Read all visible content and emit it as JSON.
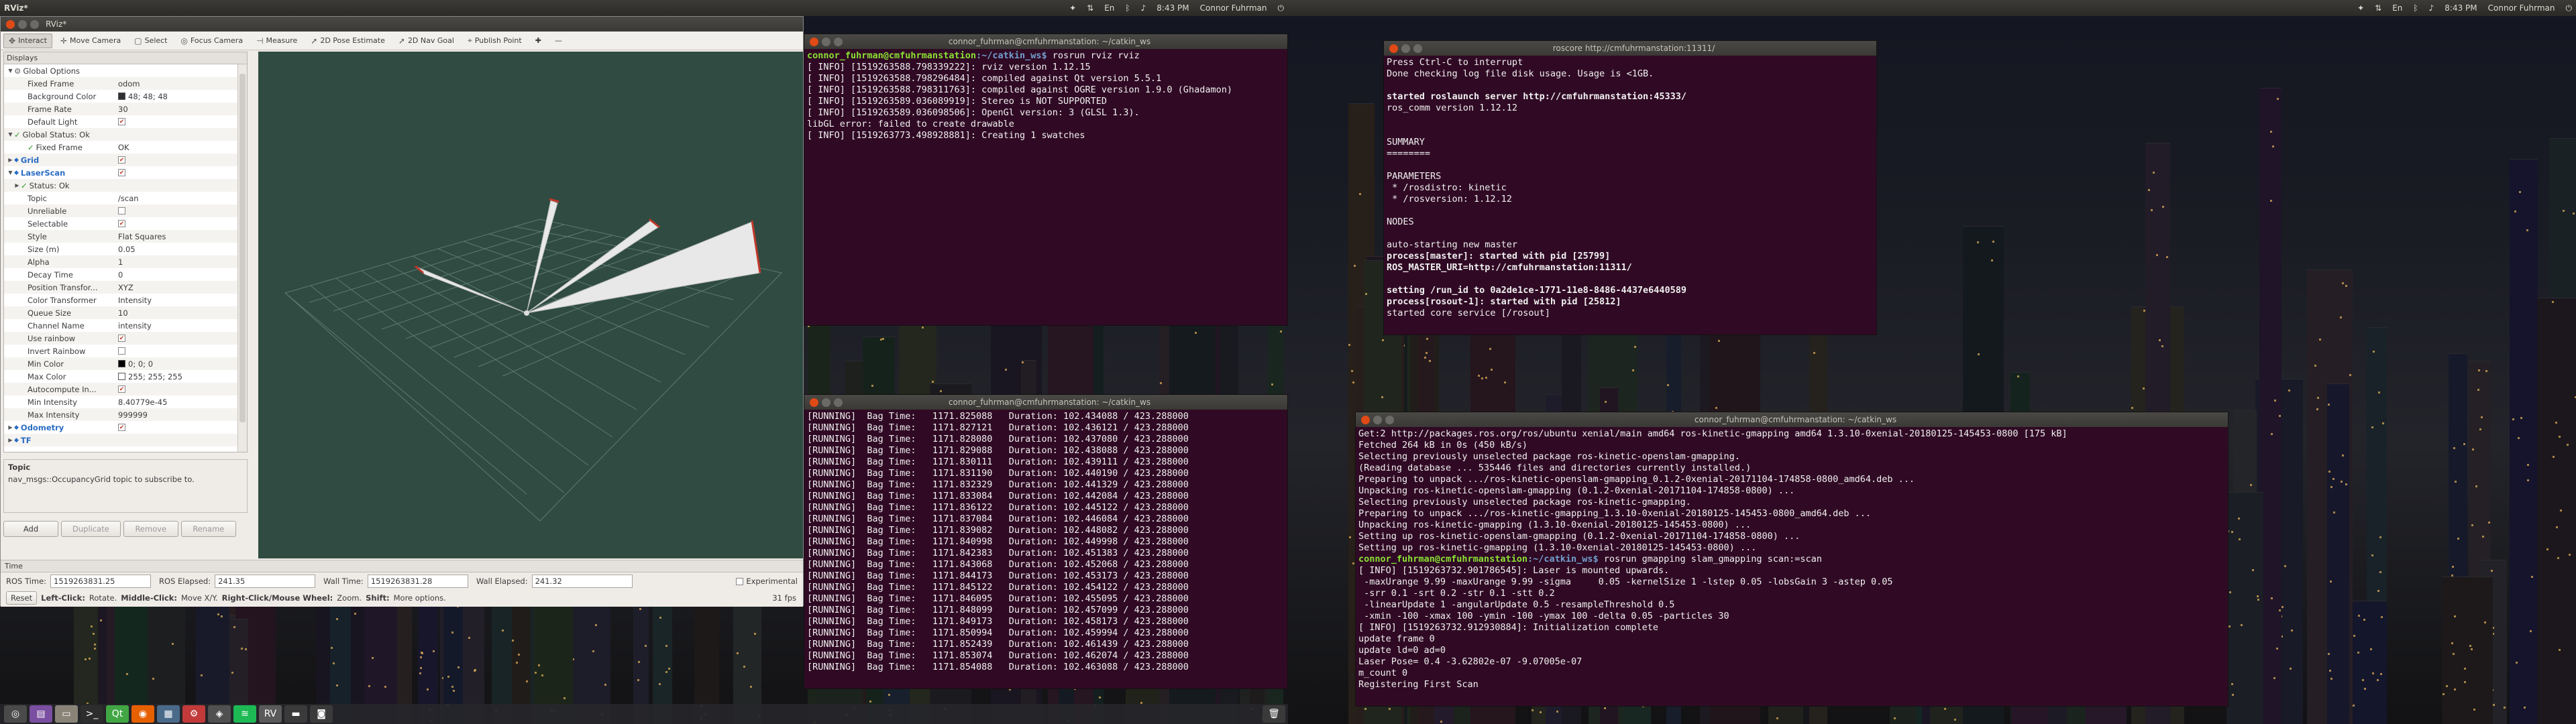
{
  "left_panel": {
    "app": "RViz*",
    "time": "8:43 PM",
    "user": "Connor Fuhrman"
  },
  "right_panel": {
    "time": "8:43 PM",
    "user": "Connor Fuhrman"
  },
  "rviz": {
    "title": "RViz*",
    "tools": [
      {
        "label": "Interact",
        "icon": "interact-icon"
      },
      {
        "label": "Move Camera",
        "icon": "move-camera-icon"
      },
      {
        "label": "Select",
        "icon": "select-icon"
      },
      {
        "label": "Focus Camera",
        "icon": "focus-camera-icon"
      },
      {
        "label": "Measure",
        "icon": "measure-icon"
      },
      {
        "label": "2D Pose Estimate",
        "icon": "pose-estimate-icon"
      },
      {
        "label": "2D Nav Goal",
        "icon": "nav-goal-icon"
      },
      {
        "label": "Publish Point",
        "icon": "publish-point-icon"
      }
    ],
    "displays_title": "Displays",
    "tree": [
      {
        "k": "Global Options",
        "v": "",
        "indent": 0,
        "exp": "▼",
        "gear": true
      },
      {
        "k": "Fixed Frame",
        "v": "odom",
        "indent": 2
      },
      {
        "k": "Background Color",
        "v": "48; 48; 48",
        "indent": 2,
        "swatch": "#303030"
      },
      {
        "k": "Frame Rate",
        "v": "30",
        "indent": 2
      },
      {
        "k": "Default Light",
        "v": "",
        "indent": 2,
        "cb": true
      },
      {
        "k": "Global Status: Ok",
        "v": "",
        "indent": 0,
        "exp": "▼",
        "ok": true
      },
      {
        "k": "Fixed Frame",
        "v": "OK",
        "indent": 2,
        "ok": true
      },
      {
        "k": "Grid",
        "v": "",
        "indent": 0,
        "exp": "▶",
        "blue": true,
        "cb": true
      },
      {
        "k": "LaserScan",
        "v": "",
        "indent": 0,
        "exp": "▼",
        "blue": true,
        "cb": true
      },
      {
        "k": "Status: Ok",
        "v": "",
        "indent": 1,
        "exp": "▶",
        "ok": true
      },
      {
        "k": "Topic",
        "v": "/scan",
        "indent": 2
      },
      {
        "k": "Unreliable",
        "v": "",
        "indent": 2,
        "cbe": true
      },
      {
        "k": "Selectable",
        "v": "",
        "indent": 2,
        "cb": true
      },
      {
        "k": "Style",
        "v": "Flat Squares",
        "indent": 2
      },
      {
        "k": "Size (m)",
        "v": "0.05",
        "indent": 2
      },
      {
        "k": "Alpha",
        "v": "1",
        "indent": 2
      },
      {
        "k": "Decay Time",
        "v": "0",
        "indent": 2
      },
      {
        "k": "Position Transfor...",
        "v": "XYZ",
        "indent": 2
      },
      {
        "k": "Color Transformer",
        "v": "Intensity",
        "indent": 2
      },
      {
        "k": "Queue Size",
        "v": "10",
        "indent": 2
      },
      {
        "k": "Channel Name",
        "v": "intensity",
        "indent": 2
      },
      {
        "k": "Use rainbow",
        "v": "",
        "indent": 2,
        "cb": true
      },
      {
        "k": "Invert Rainbow",
        "v": "",
        "indent": 2,
        "cbe": true
      },
      {
        "k": "Min Color",
        "v": "0; 0; 0",
        "indent": 2,
        "swatch": "#000000"
      },
      {
        "k": "Max Color",
        "v": "255; 255; 255",
        "indent": 2,
        "swatch": "#ffffff"
      },
      {
        "k": "Autocompute In...",
        "v": "",
        "indent": 2,
        "cb": true
      },
      {
        "k": "Min Intensity",
        "v": "8.40779e-45",
        "indent": 2
      },
      {
        "k": "Max Intensity",
        "v": "999999",
        "indent": 2
      },
      {
        "k": "Odometry",
        "v": "",
        "indent": 0,
        "exp": "▶",
        "blue": true,
        "cb": true
      },
      {
        "k": "TF",
        "v": "",
        "indent": 0,
        "exp": "▶",
        "blue": true
      }
    ],
    "desc_title": "Topic",
    "desc_text": "nav_msgs::OccupancyGrid topic to subscribe to.",
    "buttons": {
      "add": "Add",
      "duplicate": "Duplicate",
      "remove": "Remove",
      "rename": "Rename"
    },
    "time": {
      "title": "Time",
      "ros_time_label": "ROS Time:",
      "ros_time": "1519263831.25",
      "ros_elapsed_label": "ROS Elapsed:",
      "ros_elapsed": "241.35",
      "wall_time_label": "Wall Time:",
      "wall_time": "1519263831.28",
      "wall_elapsed_label": "Wall Elapsed:",
      "wall_elapsed": "241.32",
      "experimental": "Experimental"
    },
    "status": {
      "reset": "Reset",
      "hint_left": "Left-Click:",
      "hint_left_v": "Rotate.",
      "hint_mid": "Middle-Click:",
      "hint_mid_v": "Move X/Y.",
      "hint_right": "Right-Click/Mouse Wheel:",
      "hint_right_v": "Zoom.",
      "hint_shift": "Shift:",
      "hint_shift_v": "More options.",
      "fps": "31 fps"
    }
  },
  "term1": {
    "title": "connor_fuhrman@cmfuhrmanstation: ~/catkin_ws",
    "prompt_user": "connor_fuhrman@cmfuhrmanstation",
    "prompt_path": ":~/catkin_ws$",
    "cmd": " rosrun rviz rviz",
    "lines": [
      "[ INFO] [1519263588.798339222]: rviz version 1.12.15",
      "[ INFO] [1519263588.798296484]: compiled against Qt version 5.5.1",
      "[ INFO] [1519263588.798311763]: compiled against OGRE version 1.9.0 (Ghadamon)",
      "[ INFO] [1519263589.036089919]: Stereo is NOT SUPPORTED",
      "[ INFO] [1519263589.036098506]: OpenGl version: 3 (GLSL 1.3).",
      "libGL error: failed to create drawable",
      "[ INFO] [1519263773.498928881]: Creating 1 swatches"
    ]
  },
  "term2": {
    "title": "connor_fuhrman@cmfuhrmanstation: ~/catkin_ws",
    "lines": [
      "[RUNNING]  Bag Time:   1171.825088   Duration: 102.434088 / 423.288000",
      "[RUNNING]  Bag Time:   1171.827121   Duration: 102.436121 / 423.288000",
      "[RUNNING]  Bag Time:   1171.828080   Duration: 102.437080 / 423.288000",
      "[RUNNING]  Bag Time:   1171.829088   Duration: 102.438088 / 423.288000",
      "[RUNNING]  Bag Time:   1171.830111   Duration: 102.439111 / 423.288000",
      "[RUNNING]  Bag Time:   1171.831190   Duration: 102.440190 / 423.288000",
      "[RUNNING]  Bag Time:   1171.832329   Duration: 102.441329 / 423.288000",
      "[RUNNING]  Bag Time:   1171.833084   Duration: 102.442084 / 423.288000",
      "[RUNNING]  Bag Time:   1171.836122   Duration: 102.445122 / 423.288000",
      "[RUNNING]  Bag Time:   1171.837084   Duration: 102.446084 / 423.288000",
      "[RUNNING]  Bag Time:   1171.839082   Duration: 102.448082 / 423.288000",
      "[RUNNING]  Bag Time:   1171.840998   Duration: 102.449998 / 423.288000",
      "[RUNNING]  Bag Time:   1171.842383   Duration: 102.451383 / 423.288000",
      "[RUNNING]  Bag Time:   1171.843068   Duration: 102.452068 / 423.288000",
      "[RUNNING]  Bag Time:   1171.844173   Duration: 102.453173 / 423.288000",
      "[RUNNING]  Bag Time:   1171.845122   Duration: 102.454122 / 423.288000",
      "[RUNNING]  Bag Time:   1171.846095   Duration: 102.455095 / 423.288000",
      "[RUNNING]  Bag Time:   1171.848099   Duration: 102.457099 / 423.288000",
      "[RUNNING]  Bag Time:   1171.849173   Duration: 102.458173 / 423.288000",
      "[RUNNING]  Bag Time:   1171.850994   Duration: 102.459994 / 423.288000",
      "[RUNNING]  Bag Time:   1171.852439   Duration: 102.461439 / 423.288000",
      "[RUNNING]  Bag Time:   1171.853074   Duration: 102.462074 / 423.288000",
      "[RUNNING]  Bag Time:   1171.854088   Duration: 102.463088 / 423.288000"
    ]
  },
  "term3": {
    "title": "roscore http://cmfuhrmanstation:11311/",
    "lines": [
      {
        "t": "Press Ctrl-C to interrupt"
      },
      {
        "t": "Done checking log file disk usage. Usage is <1GB."
      },
      {
        "t": ""
      },
      {
        "t": "started roslaunch server http://cmfuhrmanstation:45333/",
        "b": true
      },
      {
        "t": "ros_comm version 1.12.12"
      },
      {
        "t": ""
      },
      {
        "t": ""
      },
      {
        "t": "SUMMARY"
      },
      {
        "t": "========"
      },
      {
        "t": ""
      },
      {
        "t": "PARAMETERS"
      },
      {
        "t": " * /rosdistro: kinetic"
      },
      {
        "t": " * /rosversion: 1.12.12"
      },
      {
        "t": ""
      },
      {
        "t": "NODES"
      },
      {
        "t": ""
      },
      {
        "t": "auto-starting new master"
      },
      {
        "t": "process[master]: started with pid [25799]",
        "b": true
      },
      {
        "t": "ROS_MASTER_URI=http://cmfuhrmanstation:11311/",
        "b": true
      },
      {
        "t": ""
      },
      {
        "t": "setting /run_id to 0a2de1ce-1771-11e8-8486-4437e6440589",
        "b": true
      },
      {
        "t": "process[rosout-1]: started with pid [25812]",
        "b": true
      },
      {
        "t": "started core service [/rosout]"
      }
    ]
  },
  "term4": {
    "title": "connor_fuhrman@cmfuhrmanstation: ~/catkin_ws",
    "prompt_user": "connor_fuhrman@cmfuhrmanstation",
    "prompt_path": ":~/catkin_ws$",
    "cmd": " rosrun gmapping slam_gmapping scan:=scan",
    "pre": [
      "Get:2 http://packages.ros.org/ros/ubuntu xenial/main amd64 ros-kinetic-gmapping amd64 1.3.10-0xenial-20180125-145453-0800 [175 kB]",
      "Fetched 264 kB in 0s (450 kB/s)",
      "Selecting previously unselected package ros-kinetic-openslam-gmapping.",
      "(Reading database ... 535446 files and directories currently installed.)",
      "Preparing to unpack .../ros-kinetic-openslam-gmapping_0.1.2-0xenial-20171104-174858-0800_amd64.deb ...",
      "Unpacking ros-kinetic-openslam-gmapping (0.1.2-0xenial-20171104-174858-0800) ...",
      "Selecting previously unselected package ros-kinetic-gmapping.",
      "Preparing to unpack .../ros-kinetic-gmapping_1.3.10-0xenial-20180125-145453-0800_amd64.deb ...",
      "Unpacking ros-kinetic-gmapping (1.3.10-0xenial-20180125-145453-0800) ...",
      "Setting up ros-kinetic-openslam-gmapping (0.1.2-0xenial-20171104-174858-0800) ...",
      "Setting up ros-kinetic-gmapping (1.3.10-0xenial-20180125-145453-0800) ..."
    ],
    "post": [
      "[ INFO] [1519263732.901786545]: Laser is mounted upwards.",
      " -maxUrange 9.99 -maxUrange 9.99 -sigma     0.05 -kernelSize 1 -lstep 0.05 -lobsGain 3 -astep 0.05",
      " -srr 0.1 -srt 0.2 -str 0.1 -stt 0.2",
      " -linearUpdate 1 -angularUpdate 0.5 -resampleThreshold 0.5",
      " -xmin -100 -xmax 100 -ymin -100 -ymax 100 -delta 0.05 -particles 30",
      "[ INFO] [1519263732.912930884]: Initialization complete",
      "update frame 0",
      "update ld=0 ad=0",
      "Laser Pose= 0.4 -3.62802e-07 -9.07005e-07",
      "m_count 0",
      "Registering First Scan"
    ]
  },
  "launcher": [
    {
      "icon": "dash-icon",
      "g": "◎",
      "c": "#4a4a4a"
    },
    {
      "icon": "files-icon",
      "g": "▤",
      "c": "#7a4ea0"
    },
    {
      "icon": "folder-icon",
      "g": "▭",
      "c": "#8a8478"
    },
    {
      "icon": "terminal-icon",
      "g": ">_",
      "c": "#2d2d2d"
    },
    {
      "icon": "qt-icon",
      "g": "Qt",
      "c": "#41a644"
    },
    {
      "icon": "firefox-icon",
      "g": "◉",
      "c": "#e66000"
    },
    {
      "icon": "system-icon",
      "g": "▦",
      "c": "#4a6a8a"
    },
    {
      "icon": "settings-icon",
      "g": "⚙",
      "c": "#c23a3a"
    },
    {
      "icon": "app-icon",
      "g": "◈",
      "c": "#505050"
    },
    {
      "icon": "spotify-icon",
      "g": "≋",
      "c": "#1db954"
    },
    {
      "icon": "rviz-icon",
      "g": "RV",
      "c": "#5a5a5a"
    },
    {
      "icon": "terminal2-icon",
      "g": "▬",
      "c": "#3a3a3a"
    },
    {
      "icon": "camera-icon",
      "g": "◙",
      "c": "#3a3a3a"
    }
  ]
}
